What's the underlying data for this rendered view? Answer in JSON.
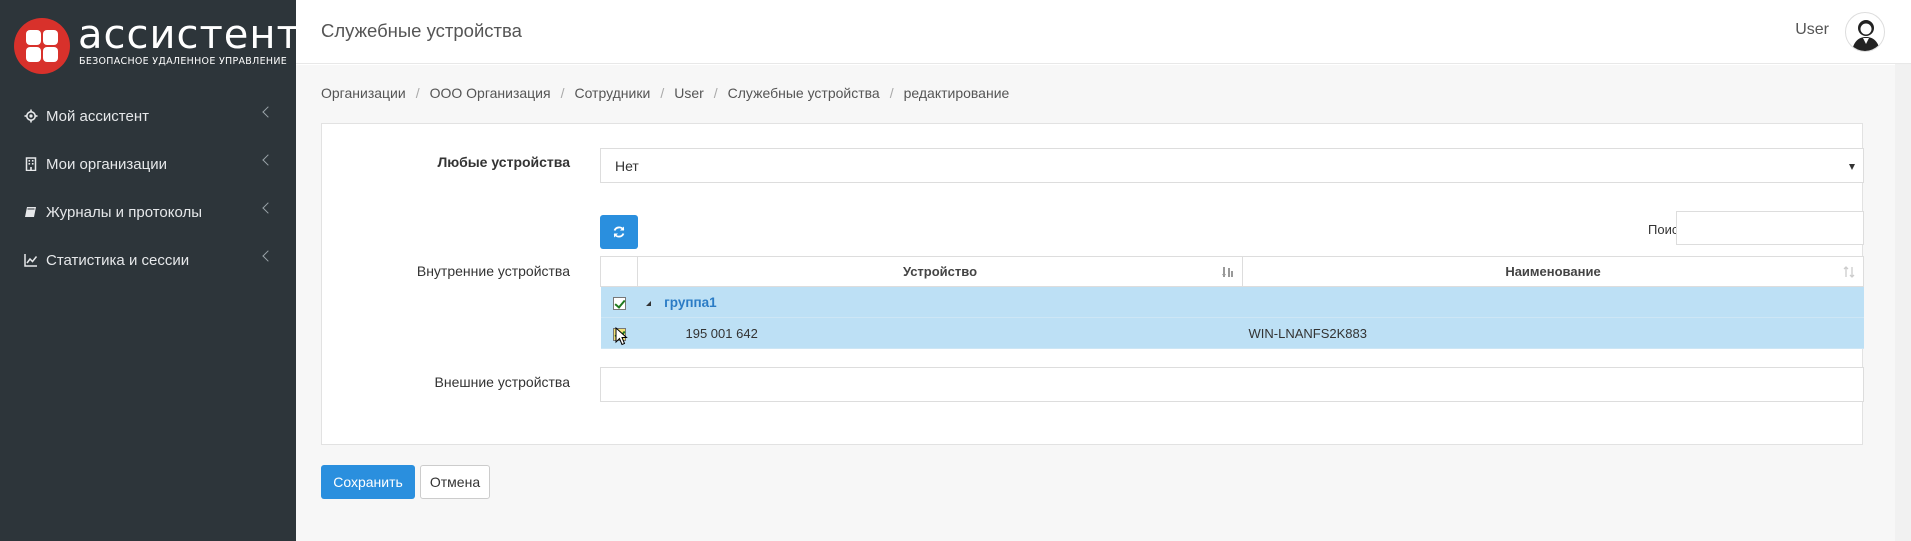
{
  "brand": {
    "name": "ассистент",
    "tagline": "БЕЗОПАСНОЕ УДАЛЕННОЕ УПРАВЛЕНИЕ",
    "color": "#d8312b"
  },
  "sidebar": {
    "items": [
      {
        "label": "Мой ассистент",
        "icon": "gear-icon"
      },
      {
        "label": "Мои организации",
        "icon": "building-icon"
      },
      {
        "label": "Журналы и протоколы",
        "icon": "book-icon"
      },
      {
        "label": "Статистика и сессии",
        "icon": "chart-icon"
      }
    ]
  },
  "header": {
    "title": "Служебные устройства",
    "user": "User"
  },
  "breadcrumb": [
    "Организации",
    "ООО Организация",
    "Сотрудники",
    "User",
    "Служебные устройства",
    "редактирование"
  ],
  "form": {
    "any_devices_label": "Любые устройства",
    "any_devices_value": "Нет",
    "internal_label": "Внутренние устройства",
    "external_label": "Внешние устройства",
    "search_label": "Поиск:",
    "search_value": ""
  },
  "table": {
    "columns": [
      "Устройство",
      "Наименование"
    ],
    "group": {
      "label": "группа1",
      "checked": true
    },
    "rows": [
      {
        "device": "195 001 642",
        "name": "WIN-LNANFS2K883",
        "checked": true
      }
    ]
  },
  "buttons": {
    "save": "Сохранить",
    "cancel": "Отмена"
  },
  "colors": {
    "sidebar_bg": "#2d353a",
    "accent": "#2a8fde",
    "row_selected": "#bde0f5"
  }
}
